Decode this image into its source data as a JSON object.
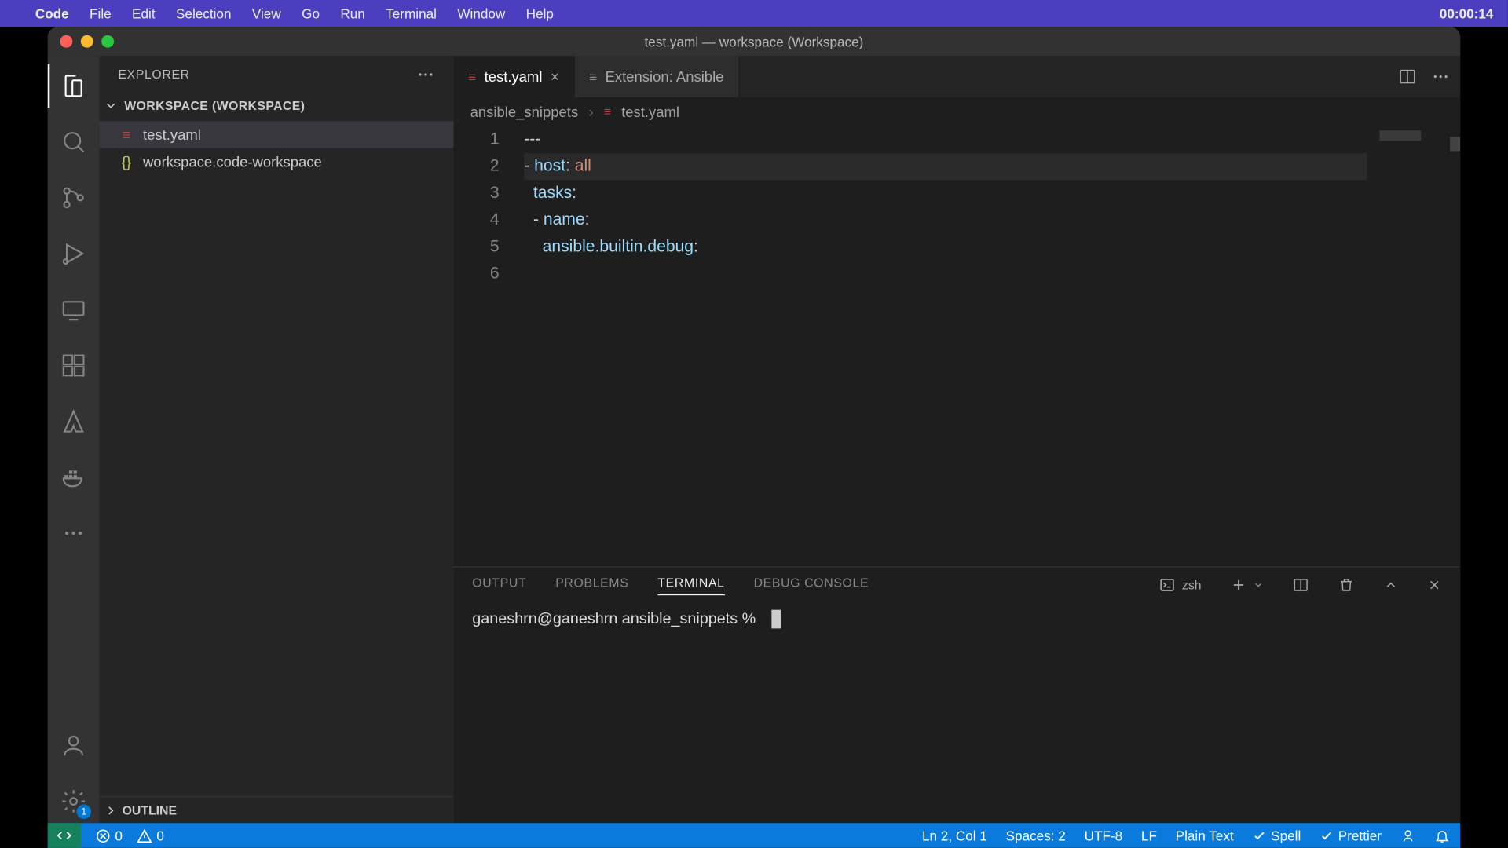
{
  "menubar": {
    "app_name": "Code",
    "items": [
      "File",
      "Edit",
      "Selection",
      "View",
      "Go",
      "Run",
      "Terminal",
      "Window",
      "Help"
    ],
    "clock": "00:00:14"
  },
  "window": {
    "title": "test.yaml — workspace (Workspace)"
  },
  "sidebar": {
    "header": "EXPLORER",
    "workspace_label": "WORKSPACE (WORKSPACE)",
    "files": [
      {
        "name": "test.yaml",
        "icon": "yaml",
        "selected": true
      },
      {
        "name": "workspace.code-workspace",
        "icon": "json",
        "selected": false
      }
    ],
    "outline_label": "OUTLINE"
  },
  "activity_badge": "1",
  "tabs": [
    {
      "label": "test.yaml",
      "active": true,
      "closeable": true,
      "icon": "yaml"
    },
    {
      "label": "Extension: Ansible",
      "active": false,
      "closeable": false,
      "icon": "ext"
    }
  ],
  "breadcrumbs": {
    "folder": "ansible_snippets",
    "file": "test.yaml"
  },
  "code": {
    "lines": [
      "---",
      "- host: all",
      "  tasks:",
      "  - name:",
      "    ansible.builtin.debug:",
      ""
    ],
    "current_line_index": 1
  },
  "panel": {
    "tabs": [
      "OUTPUT",
      "PROBLEMS",
      "TERMINAL",
      "DEBUG CONSOLE"
    ],
    "active_tab": "TERMINAL",
    "shell_label": "zsh",
    "prompt": "ganeshrn@ganeshrn ansible_snippets %"
  },
  "statusbar": {
    "errors": "0",
    "warnings": "0",
    "cursor": "Ln 2, Col 1",
    "spaces": "Spaces: 2",
    "encoding": "UTF-8",
    "eol": "LF",
    "language": "Plain Text",
    "spell": "Spell",
    "prettier": "Prettier"
  }
}
